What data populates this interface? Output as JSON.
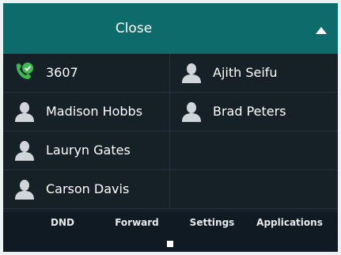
{
  "header": {
    "title": "Close"
  },
  "contacts": [
    {
      "left": "3607",
      "right": "Ajith Seifu"
    },
    {
      "left": "Madison Hobbs",
      "right": "Brad Peters"
    },
    {
      "left": "Lauryn Gates",
      "right": ""
    },
    {
      "left": "Carson Davis",
      "right": ""
    }
  ],
  "softkeys": [
    "DND",
    "Forward",
    "Settings",
    "Applications"
  ],
  "colors": {
    "header": "#0e6b6b",
    "background": "#0f1a22",
    "call_icon_green": "#3dba4e",
    "person_icon": "#cfd5d8"
  },
  "icons": {
    "first_contact": "phone-active-icon",
    "contact": "person-icon",
    "collapse": "triangle-up-icon"
  }
}
